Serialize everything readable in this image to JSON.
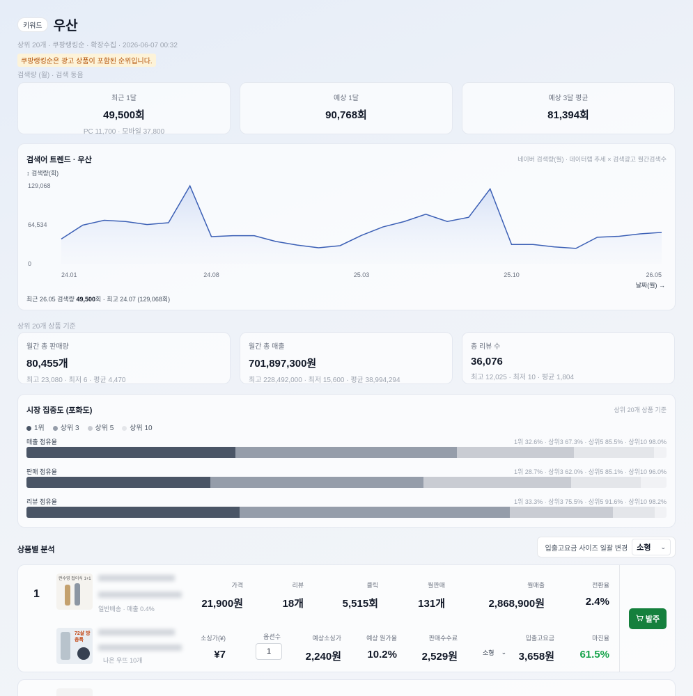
{
  "header": {
    "badge": "키워드",
    "keyword": "우산",
    "meta": "상위 20개 · 쿠팡랭킹순 · 확장수집 · 2026-06-07 00:32",
    "warning": "쿠팡랭킹순은 광고 상품이 포함된 순위입니다."
  },
  "search_section_label": "검색량 (월) · 검색 동음",
  "search_stats": [
    {
      "label": "최근 1달",
      "value": "49,500회",
      "sub": "PC 11,700 · 모바일 37,800"
    },
    {
      "label": "예상 1달",
      "value": "90,768회",
      "sub": ""
    },
    {
      "label": "예상 3달 평균",
      "value": "81,394회",
      "sub": ""
    }
  ],
  "trend": {
    "title": "검색어 트렌드 · 우산",
    "note": "네이버 검색량(월) · 데이터랩 추세 × 검색광고 월간검색수",
    "y_label": "↕ 검색량(회)",
    "x_label": "날짜(월) →",
    "footer_prefix": "최근 26.05 검색량 ",
    "footer_value": "49,500",
    "footer_suffix": "회 · 최고 24.07 (129,068회)"
  },
  "chart_data": {
    "type": "area",
    "title": "검색어 트렌드 · 우산",
    "xlabel": "날짜(월)",
    "ylabel": "검색량(회)",
    "ylim": [
      0,
      129068
    ],
    "y_ticks": [
      "129,068",
      "64,534",
      "0"
    ],
    "x_ticks": [
      "24.01",
      "24.08",
      "25.03",
      "25.10",
      "26.05"
    ],
    "x": [
      "24.01",
      "24.02",
      "24.03",
      "24.04",
      "24.05",
      "24.06",
      "24.07",
      "24.08",
      "24.09",
      "24.10",
      "24.11",
      "24.12",
      "25.01",
      "25.02",
      "25.03",
      "25.04",
      "25.05",
      "25.06",
      "25.07",
      "25.08",
      "25.09",
      "25.10",
      "25.11",
      "25.12",
      "26.01",
      "26.02",
      "26.03",
      "26.04",
      "26.05"
    ],
    "series": [
      {
        "values": [
          41000,
          64000,
          72000,
          70000,
          65000,
          68000,
          129068,
          45000,
          46500,
          46500,
          37000,
          31000,
          26500,
          30000,
          47000,
          61000,
          70000,
          82000,
          70000,
          77000,
          124000,
          32000,
          32000,
          28000,
          25500,
          44000,
          45500,
          49500,
          52000
        ]
      }
    ],
    "grid": false
  },
  "top20_label": "상위 20개 상품 기준",
  "market_stats": [
    {
      "label": "월간 총 판매량",
      "value": "80,455개",
      "sub": "최고 23,080 · 최저 6 · 평균 4,470"
    },
    {
      "label": "월간 총 매출",
      "value": "701,897,300원",
      "sub": "최고 228,492,000 · 최저 15,600 · 평균 38,994,294"
    },
    {
      "label": "총 리뷰 수",
      "value": "36,076",
      "sub": "최고 12,025 · 최저 10 · 평균 1,804"
    }
  ],
  "concentration": {
    "title": "시장 집중도 (포화도)",
    "note": "상위 20개 상품 기준",
    "legend": [
      "1위",
      "상위 3",
      "상위 5",
      "상위 10"
    ],
    "colors": [
      "#4a5566",
      "#959daa",
      "#c9ccd3",
      "#e4e6ea"
    ],
    "rows": [
      {
        "label": "매출 점유율",
        "summary": "1위 32.6% · 상위3 67.3% · 상위5 85.5% · 상위10 98.0%",
        "values": [
          32.6,
          67.3,
          85.5,
          98.0
        ]
      },
      {
        "label": "판매 점유율",
        "summary": "1위 28.7% · 상위3 62.0% · 상위5 85.1% · 상위10 96.0%",
        "values": [
          28.7,
          62.0,
          85.1,
          96.0
        ]
      },
      {
        "label": "리뷰 점유율",
        "summary": "1위 33.3% · 상위3 75.5% · 상위5 91.6% · 상위10 98.2%",
        "values": [
          33.3,
          75.5,
          91.6,
          98.2
        ]
      }
    ]
  },
  "products": {
    "title": "상품별 분석",
    "size_label": "입출고요금 사이즈 일괄 변경",
    "size_value": "소형",
    "items": [
      {
        "rank": "1",
        "thumb_text": "런수영 접이식 1+1",
        "sub_note": "일반배송 · 매출 0.4%",
        "sub_note2": "나은 우뜨 10개",
        "row1": [
          {
            "label": "가격",
            "value": "21,900원"
          },
          {
            "label": "리뷰",
            "value": "18개"
          },
          {
            "label": "클릭",
            "value": "5,515회"
          },
          {
            "label": "월판매",
            "value": "131개"
          },
          {
            "label": "월매출",
            "value": "2,868,900원"
          },
          {
            "label": "전환율",
            "value": "2.4%"
          }
        ],
        "row2": [
          {
            "label": "소싱가(¥)",
            "value": "¥7"
          },
          {
            "label": "옵션수",
            "value": "1"
          },
          {
            "label": "예상소싱가",
            "value": "2,240원"
          },
          {
            "label": "예상 원가율",
            "value": "10.2%"
          },
          {
            "label": "판매수수료",
            "value": "2,529원"
          },
          {
            "label": "입출고요금",
            "value": "3,658원"
          },
          {
            "label": "마진율",
            "value": "61.5%"
          }
        ],
        "size_small": "소형",
        "order_label": "발주",
        "thumb2_text": "72살 방충특"
      }
    ]
  }
}
